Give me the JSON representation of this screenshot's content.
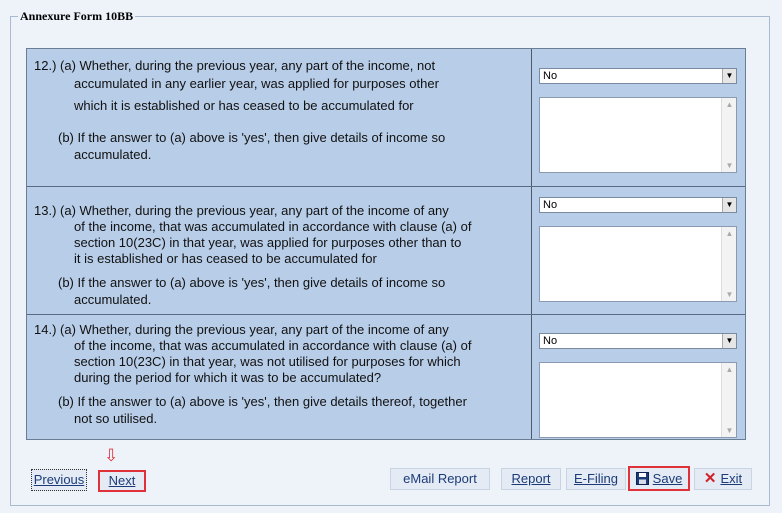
{
  "form": {
    "title": "Annexure Form 10BB"
  },
  "questions": [
    {
      "a_lines": [
        "12.) (a) Whether, during the previous year, any part of the income, not",
        "accumulated in any earlier year, was applied for purposes other",
        "which it is established or has ceased to be accumulated for"
      ],
      "b_lines": [
        "(b) If the answer to (a) above is 'yes', then give details of  income so",
        "accumulated."
      ],
      "select_value": "No"
    },
    {
      "a_lines": [
        "13.) (a) Whether, during the previous year, any part of the income of any",
        "of the income, that was accumulated in accordance with clause (a) of",
        "section 10(23C) in that year, was applied for purposes other than to",
        "it is established or has ceased to be accumulated for"
      ],
      "b_lines": [
        "(b) If the answer to (a) above is 'yes', then give details of income so",
        "accumulated."
      ],
      "select_value": "No"
    },
    {
      "a_lines": [
        "14.) (a) Whether, during the previous year, any part of the income of any",
        "of the income, that was accumulated in accordance with clause (a) of",
        "section 10(23C) in that year, was not utilised for purposes for which",
        "during the period for which it  was to be accumulated?"
      ],
      "b_lines": [
        "(b) If the answer to (a) above is 'yes', then give details thereof, together",
        "not so utilised."
      ],
      "select_value": "No"
    }
  ],
  "buttons": {
    "previous": "Previous",
    "next": "Next",
    "email_report": "eMail Report",
    "report": "Report",
    "efiling": "E-Filing",
    "save": "Save",
    "exit": "Exit"
  },
  "icons": {
    "hint_arrow": "down-arrow-outline",
    "save": "floppy-disk",
    "exit": "red-x"
  },
  "colors": {
    "form_background": "#b8cde8",
    "highlight_border": "#e0303a",
    "link_text": "#1b3b78"
  }
}
